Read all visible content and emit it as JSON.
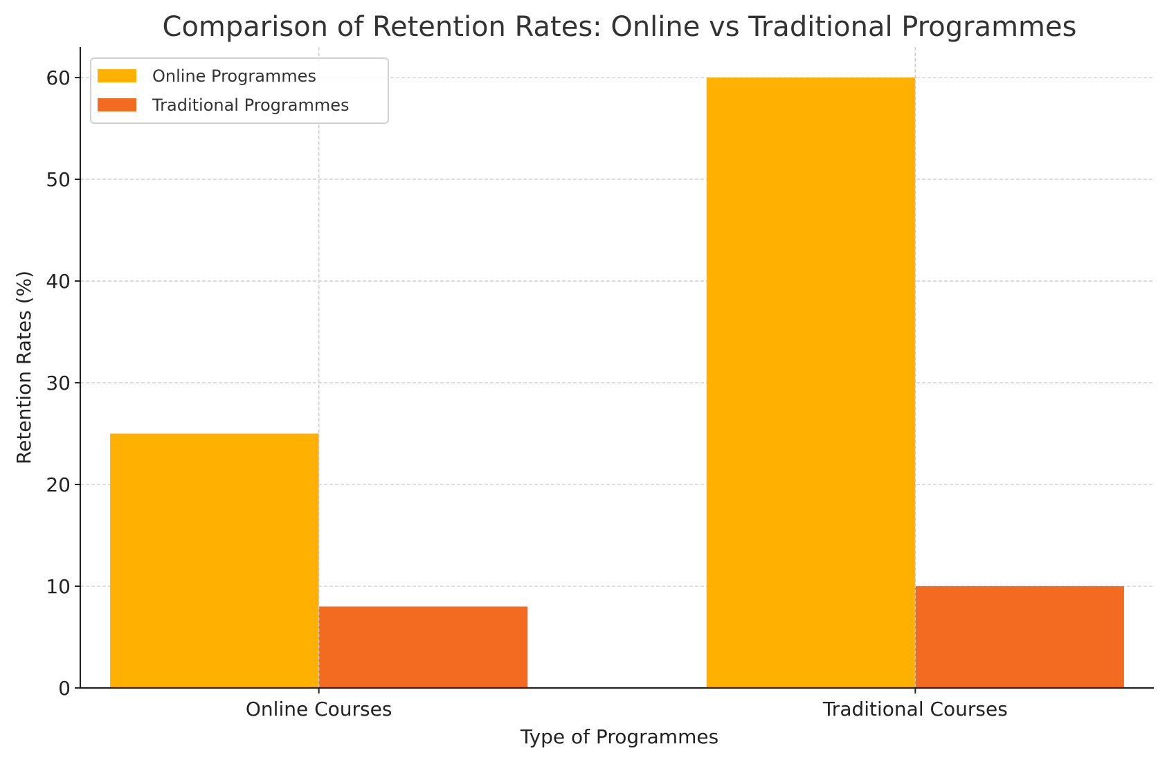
{
  "chart_data": {
    "type": "bar",
    "title": "Comparison of Retention Rates: Online vs Traditional Programmes",
    "xlabel": "Type of Programmes",
    "ylabel": "Retention Rates (%)",
    "categories": [
      "Online Courses",
      "Traditional Courses"
    ],
    "series": [
      {
        "name": "Online Programmes",
        "color": "#FFB000",
        "values": [
          25,
          60
        ]
      },
      {
        "name": "Traditional Programmes",
        "color": "#F26B21",
        "values": [
          8,
          10
        ]
      }
    ],
    "ylim": [
      0,
      63
    ],
    "yticks": [
      0,
      10,
      20,
      30,
      40,
      50,
      60
    ],
    "ytick_labels": [
      "0",
      "10",
      "20",
      "30",
      "40",
      "50",
      "60"
    ],
    "grid": true,
    "legend_position": "top-left"
  }
}
